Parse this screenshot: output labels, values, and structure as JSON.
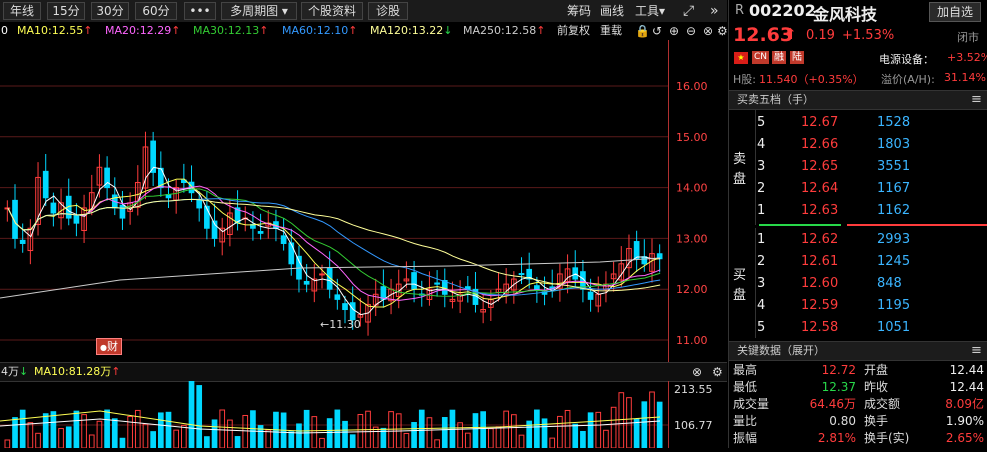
{
  "toolbar": {
    "periods": [
      "年线",
      "15分",
      "30分",
      "60分"
    ],
    "more": "•••",
    "multi_period": "多周期图",
    "stock_info": "个股资料",
    "diagnose": "诊股",
    "chips": "筹码",
    "draw": "画线",
    "tools": "工具"
  },
  "ma_bar": {
    "ma5": "0",
    "ma10": "MA10:12.55",
    "ma20": "MA20:12.29",
    "ma30": "MA30:12.13",
    "ma60": "MA60:12.10",
    "ma120": "MA120:13.22",
    "ma250": "MA250:12.58",
    "adjust": "前复权",
    "overlay": "重载"
  },
  "price_chart": {
    "y_labels": [
      "16.00",
      "15.00",
      "14.00",
      "13.00",
      "12.00",
      "11.00"
    ],
    "low_annotation": "←11.30",
    "event_badge": "财"
  },
  "volume_header": {
    "vol_label": "4万",
    "ma10": "MA10:81.28万",
    "y_labels": [
      "213.55",
      "106.77"
    ]
  },
  "quote": {
    "prefix": "R",
    "code": "002202",
    "name": "金风科技",
    "add_button": "加自选",
    "price": "12.63",
    "change": "0.19",
    "change_pct": "+1.53%",
    "status": "闭市",
    "tags": [
      "CN",
      "融",
      "陆"
    ],
    "sector": "电源设备：",
    "sector_change": "+3.52%",
    "h_share_label": "H股:",
    "h_share_value": "11.540（+0.35%）",
    "premium_label": "溢价(A/H):",
    "premium_value": "31.14%"
  },
  "orderbook": {
    "title": "买卖五档（手）",
    "sell_label": [
      "卖",
      "盘"
    ],
    "buy_label": [
      "买",
      "盘"
    ],
    "asks": [
      {
        "level": "5",
        "price": "12.67",
        "qty": "1528"
      },
      {
        "level": "4",
        "price": "12.66",
        "qty": "1803"
      },
      {
        "level": "3",
        "price": "12.65",
        "qty": "3551"
      },
      {
        "level": "2",
        "price": "12.64",
        "qty": "1167"
      },
      {
        "level": "1",
        "price": "12.63",
        "qty": "1162"
      }
    ],
    "bids": [
      {
        "level": "1",
        "price": "12.62",
        "qty": "2993"
      },
      {
        "level": "2",
        "price": "12.61",
        "qty": "1245"
      },
      {
        "level": "3",
        "price": "12.60",
        "qty": "848"
      },
      {
        "level": "4",
        "price": "12.59",
        "qty": "1195"
      },
      {
        "level": "5",
        "price": "12.58",
        "qty": "1051"
      }
    ]
  },
  "key_data": {
    "title": "关键数据（展开）",
    "rows": [
      {
        "l1": "最高",
        "v1": "12.72",
        "l2": "开盘",
        "v2": "12.44"
      },
      {
        "l1": "最低",
        "v1": "12.37",
        "l2": "昨收",
        "v2": "12.44"
      },
      {
        "l1": "成交量",
        "v1": "64.46万",
        "l2": "成交额",
        "v2": "8.09亿"
      },
      {
        "l1": "量比",
        "v1": "0.80",
        "l2": "换手",
        "v2": "1.90%"
      },
      {
        "l1": "振幅",
        "v1": "2.81%",
        "l2": "换手(实)",
        "v2": "2.65%"
      }
    ]
  },
  "colors": {
    "up": "#ff3c3c",
    "down": "#00d8ff",
    "ma5": "#ffffff",
    "ma10": "#ffff55",
    "ma20": "#ff66ff",
    "ma30": "#33cc33",
    "ma60": "#3399ff",
    "ma120": "#ffff99",
    "ma250": "#cccccc"
  }
}
